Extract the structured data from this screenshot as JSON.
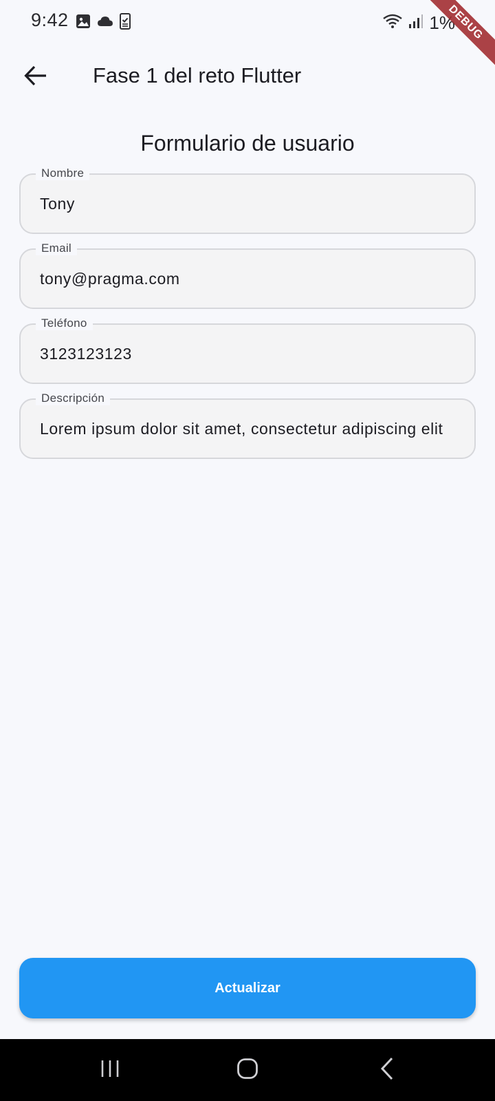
{
  "status_bar": {
    "time": "9:42",
    "left_icons": [
      "image-icon",
      "cloud-icon",
      "phone-check-icon"
    ],
    "right_icons": [
      "wifi-icon",
      "signal-icon"
    ],
    "battery": "1%"
  },
  "debug_banner": {
    "label": "DEBUG",
    "color": "#a12a2e"
  },
  "app_bar": {
    "back_icon": "arrow-left-icon",
    "title": "Fase 1 del reto Flutter"
  },
  "form": {
    "title": "Formulario de usuario",
    "fields": [
      {
        "label": "Nombre",
        "value": "Tony"
      },
      {
        "label": "Email",
        "value": "tony@pragma.com"
      },
      {
        "label": "Teléfono",
        "value": "3123123123"
      },
      {
        "label": "Descripción",
        "value": "Lorem ipsum dolor sit amet, consectetur adipiscing elit"
      }
    ]
  },
  "action_button": {
    "label": "Actualizar",
    "color": "#2196f3"
  },
  "nav_bar": {
    "icons": [
      "recent-apps-icon",
      "home-icon",
      "back-nav-icon"
    ]
  }
}
